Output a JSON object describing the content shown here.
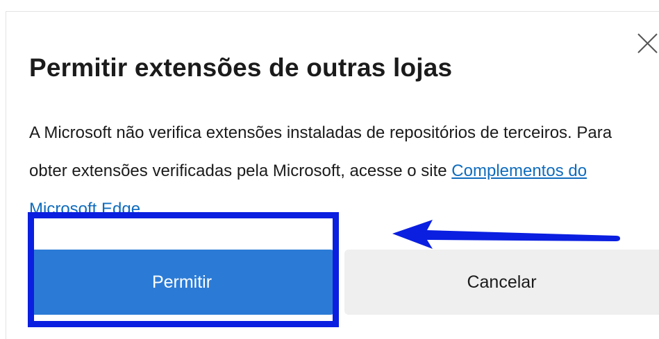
{
  "dialog": {
    "title": "Permitir extensões de outras lojas",
    "body_text": "A Microsoft não verifica extensões instaladas de repositórios de terceiros. Para obter extensões verificadas pela Microsoft, acesse o site ",
    "link_text": "Complementos do Microsoft Edge",
    "body_suffix": ".",
    "allow_label": "Permitir",
    "cancel_label": "Cancelar",
    "close_icon": "close-icon"
  },
  "annotations": {
    "highlight_color": "#0a1fe0",
    "arrow_color": "#0a1fe0"
  },
  "colors": {
    "accent": "#2b7bd6",
    "link": "#0f6cbd",
    "secondary_button": "#efefef"
  }
}
